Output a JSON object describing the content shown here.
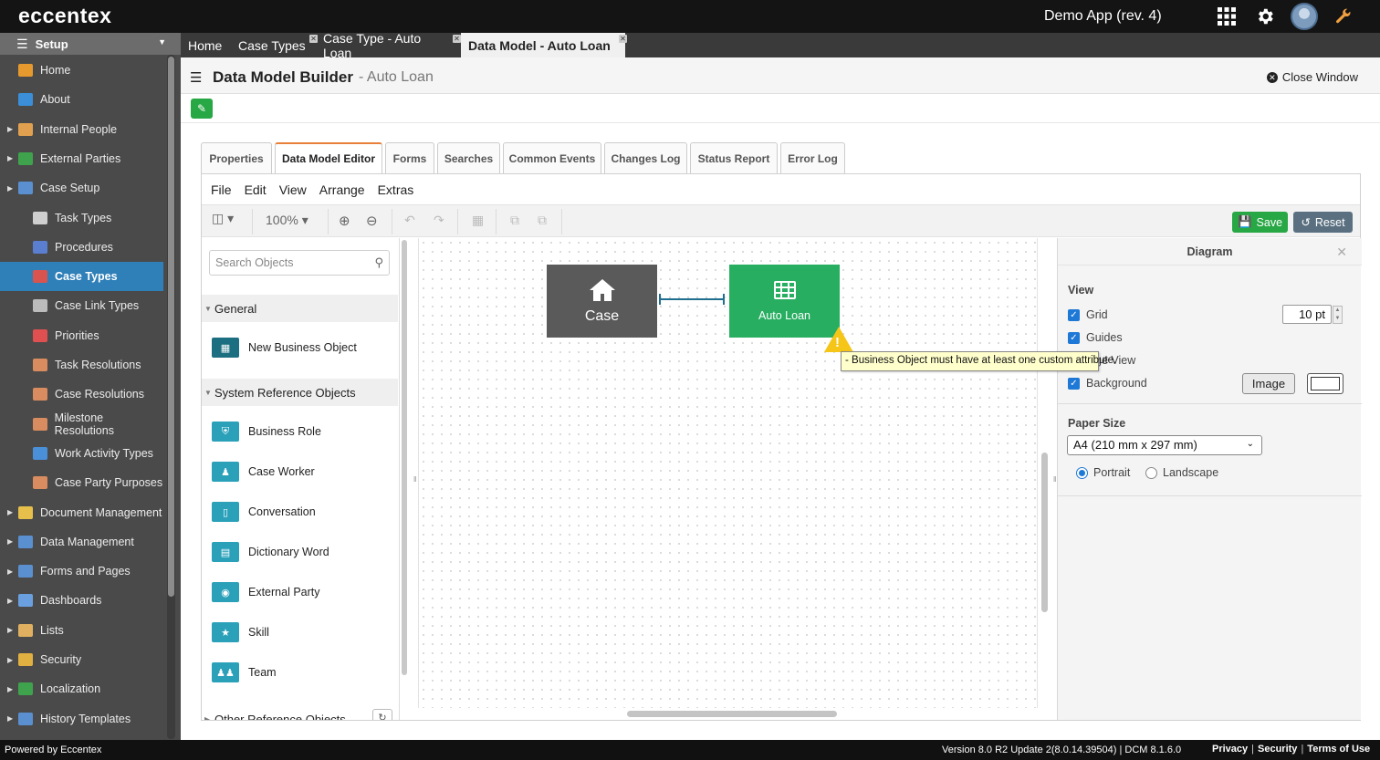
{
  "topbar": {
    "brand": "eccentex",
    "app_title": "Demo App (rev. 4)",
    "icons": [
      "grid-apps-icon",
      "gear-icon",
      "avatar",
      "wrench-icon"
    ]
  },
  "sidebar": {
    "header": "Setup",
    "items": [
      {
        "label": "Home",
        "icon": "home-icon",
        "indent": 1,
        "expandable": false
      },
      {
        "label": "About",
        "icon": "info-icon",
        "indent": 1,
        "expandable": false
      },
      {
        "label": "Internal People",
        "icon": "people-icon",
        "indent": 1,
        "expandable": true
      },
      {
        "label": "External Parties",
        "icon": "globe-icon",
        "indent": 1,
        "expandable": true
      },
      {
        "label": "Case Setup",
        "icon": "tree-icon",
        "indent": 1,
        "expandable": true
      },
      {
        "label": "Task Types",
        "icon": "cube-icon",
        "indent": 2,
        "expandable": false
      },
      {
        "label": "Procedures",
        "icon": "procedure-icon",
        "indent": 2,
        "expandable": false
      },
      {
        "label": "Case Types",
        "icon": "case-types-icon",
        "indent": 2,
        "expandable": false,
        "active": true
      },
      {
        "label": "Case Link Types",
        "icon": "link-icon",
        "indent": 2,
        "expandable": false
      },
      {
        "label": "Priorities",
        "icon": "priority-icon",
        "indent": 2,
        "expandable": false
      },
      {
        "label": "Task Resolutions",
        "icon": "tag-icon",
        "indent": 2,
        "expandable": false
      },
      {
        "label": "Case Resolutions",
        "icon": "tag-icon",
        "indent": 2,
        "expandable": false
      },
      {
        "label": "Milestone Resolutions",
        "icon": "tag-icon",
        "indent": 2,
        "expandable": false
      },
      {
        "label": "Work Activity Types",
        "icon": "activity-icon",
        "indent": 2,
        "expandable": false
      },
      {
        "label": "Case Party Purposes",
        "icon": "tag-icon",
        "indent": 2,
        "expandable": false
      },
      {
        "label": "Document Management",
        "icon": "folder-icon",
        "indent": 1,
        "expandable": true
      },
      {
        "label": "Data Management",
        "icon": "table-icon",
        "indent": 1,
        "expandable": true
      },
      {
        "label": "Forms and Pages",
        "icon": "form-icon",
        "indent": 1,
        "expandable": true
      },
      {
        "label": "Dashboards",
        "icon": "dashboard-icon",
        "indent": 1,
        "expandable": true
      },
      {
        "label": "Lists",
        "icon": "list-icon",
        "indent": 1,
        "expandable": true
      },
      {
        "label": "Security",
        "icon": "lock-icon",
        "indent": 1,
        "expandable": true
      },
      {
        "label": "Localization",
        "icon": "globe-icon",
        "indent": 1,
        "expandable": true
      },
      {
        "label": "History Templates",
        "icon": "history-icon",
        "indent": 1,
        "expandable": true
      }
    ]
  },
  "tabs": [
    {
      "label": "Home",
      "closable": false,
      "active": false
    },
    {
      "label": "Case Types",
      "closable": true,
      "active": false
    },
    {
      "label": "Case Type - Auto Loan",
      "closable": true,
      "active": false
    },
    {
      "label": "Data Model - Auto Loan",
      "closable": true,
      "active": true
    }
  ],
  "page": {
    "title": "Data Model Builder",
    "subtitle": "- Auto Loan",
    "close_label": "Close Window"
  },
  "content_tabs": [
    "Properties",
    "Data Model Editor",
    "Forms",
    "Searches",
    "Common Events",
    "Changes Log",
    "Status Report",
    "Error Log"
  ],
  "active_content_tab": "Data Model Editor",
  "menu": [
    "File",
    "Edit",
    "View",
    "Arrange",
    "Extras"
  ],
  "toolbar": {
    "zoom": "100%",
    "save_label": "Save",
    "reset_label": "Reset"
  },
  "palette": {
    "search_placeholder": "Search Objects",
    "sections": [
      {
        "title": "General",
        "items": [
          {
            "label": "New Business Object",
            "icon": "table-icon"
          }
        ]
      },
      {
        "title": "System Reference Objects",
        "items": [
          {
            "label": "Business Role",
            "icon": "shield-icon"
          },
          {
            "label": "Case Worker",
            "icon": "user-icon"
          },
          {
            "label": "Conversation",
            "icon": "book-icon"
          },
          {
            "label": "Dictionary Word",
            "icon": "document-icon"
          },
          {
            "label": "External Party",
            "icon": "globe-icon"
          },
          {
            "label": "Skill",
            "icon": "star-icon"
          },
          {
            "label": "Team",
            "icon": "team-icon"
          }
        ]
      },
      {
        "title": "Other Reference Objects",
        "items": []
      }
    ]
  },
  "canvas": {
    "nodes": [
      {
        "label": "Case",
        "color": "#5a5a5a",
        "icon": "home-icon"
      },
      {
        "label": "Auto Loan",
        "color": "#27ae60",
        "icon": "table-icon"
      }
    ],
    "warning_tooltip": "- Business Object must have at least one custom attribute."
  },
  "format_panel": {
    "title": "Diagram",
    "view_title": "View",
    "grid_label": "Grid",
    "grid_checked": true,
    "grid_size": "10 pt",
    "guides_label": "Guides",
    "guides_checked": true,
    "page_view_label": "ge View",
    "background_label": "Background",
    "background_checked": true,
    "image_button": "Image",
    "paper_size_title": "Paper Size",
    "paper_size_value": "A4 (210 mm x 297 mm)",
    "orientation": {
      "portrait": "Portrait",
      "landscape": "Landscape",
      "selected": "Portrait"
    }
  },
  "footer": {
    "left": "Powered by Eccentex",
    "version": "Version   8.0 R2 Update 2(8.0.14.39504) | DCM 8.1.6.0",
    "links": [
      "Privacy",
      "Security",
      "Terms of Use"
    ]
  },
  "colors": {
    "accent_blue": "#2f7fb8",
    "save_green": "#28a745",
    "node_green": "#27ae60",
    "warning_yellow": "#f5c518"
  }
}
